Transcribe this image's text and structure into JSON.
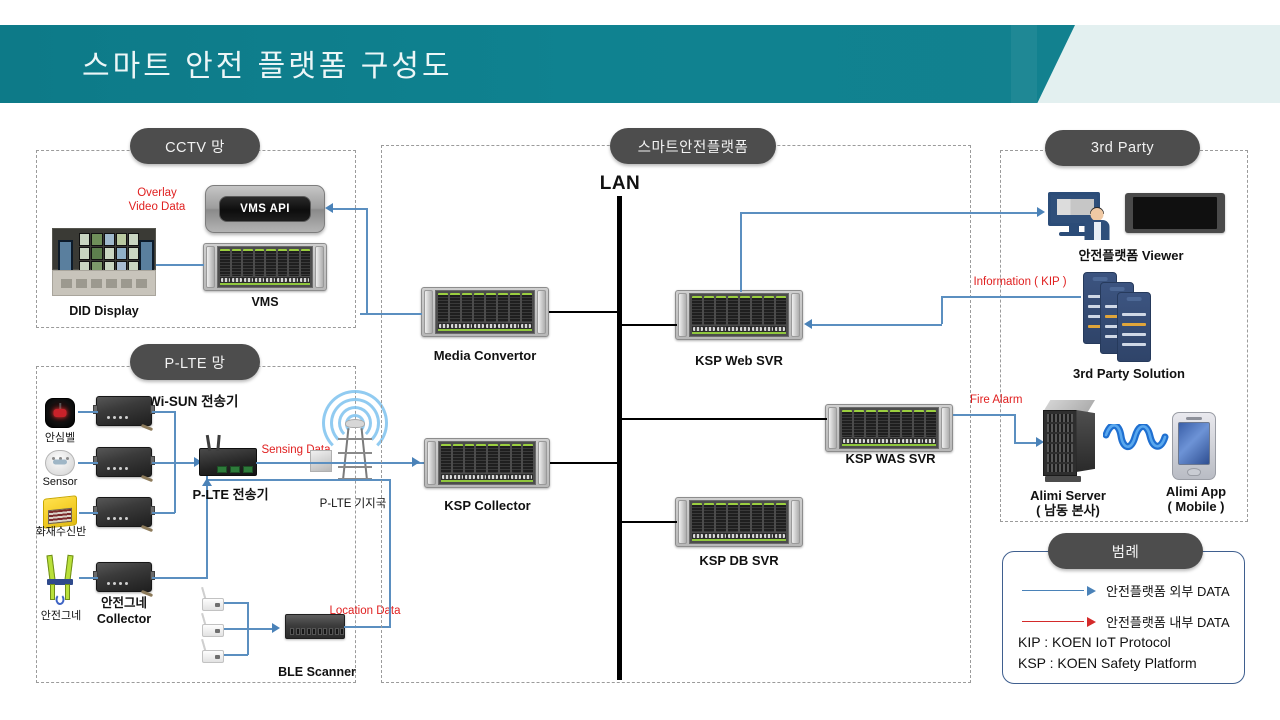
{
  "header": {
    "title": "스마트 안전 플랫폼 구성도",
    "bar_color": "#0f8290",
    "light_band_color": "#e3f0f0",
    "title_color": "#ecf6f7"
  },
  "zones": [
    {
      "id": "cctv",
      "label": "CCTV 망"
    },
    {
      "id": "plte",
      "label": "P-LTE 망"
    },
    {
      "id": "platform",
      "label": "스마트안전플랫폼"
    },
    {
      "id": "thirdparty",
      "label": "3rd Party"
    },
    {
      "id": "legend",
      "label": "범례"
    }
  ],
  "cctv": {
    "api_box_label": "VMS API",
    "vms_label": "VMS",
    "did_label": "DID  Display",
    "overlay_label_line1": "Overlay",
    "overlay_label_line2": "Video Data"
  },
  "plte": {
    "devices": [
      {
        "name": "안심벨",
        "icon": "safety-bell-icon"
      },
      {
        "name": "Sensor",
        "icon": "smoke-sensor-icon"
      },
      {
        "name": "화재수신반",
        "icon": "fire-receiver-icon"
      },
      {
        "name": "안전그네",
        "icon": "safety-harness-icon"
      }
    ],
    "wisun_label": "Wi-SUN 전송기",
    "harness_collector_line1": "안전그네",
    "harness_collector_line2": "Collector",
    "plte_tx_label": "P-LTE 전송기",
    "basestation_label": "P-LTE 기지국",
    "ble_label": "BLE Scanner",
    "sensing_data_label": "Sensing Data",
    "location_data_label": "Location Data"
  },
  "platform": {
    "lan_label": "LAN",
    "media_convertor_label": "Media  Convertor",
    "ksp_collector_label": "KSP  Collector",
    "ksp_web_label": "KSP  Web  SVR",
    "ksp_was_label": "KSP  WAS  SVR",
    "ksp_db_label": "KSP  DB  SVR"
  },
  "thirdparty": {
    "viewer_label": "안전플랫폼  Viewer",
    "solution_label": "3rd Party  Solution",
    "information_label": "Information ( KIP )",
    "fire_alarm_label": "Fire Alarm",
    "alimi_server_line1": "Alimi Server",
    "alimi_server_line2": "( 남동  본사)",
    "alimi_app_line1": "Alimi App",
    "alimi_app_line2": "( Mobile )"
  },
  "legend": {
    "title": "범례",
    "rows": [
      {
        "color": "#4a82b8",
        "text": "안전플랫폼  외부  DATA"
      },
      {
        "color": "#d42a2a",
        "text": "안전플랫폼  내부  DATA"
      }
    ],
    "notes": [
      "KIP : KOEN IoT Protocol",
      "KSP : KOEN Safety Platform"
    ]
  },
  "colors": {
    "external_data_arrow": "#4a82b8",
    "internal_data_arrow": "#d42a2a",
    "lan_bus": "#000000",
    "zone_border": "#9b9b9b",
    "pill_background": "#4d4d4d"
  }
}
